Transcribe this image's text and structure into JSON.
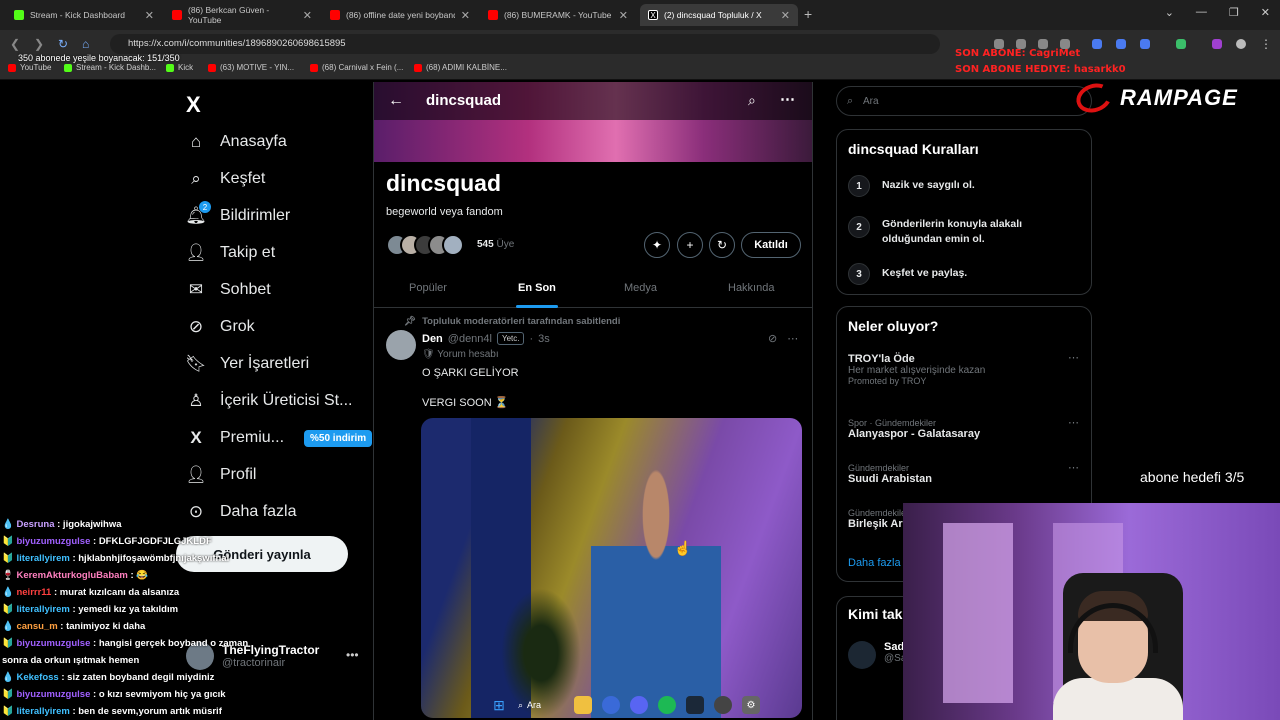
{
  "browser": {
    "tabs": [
      {
        "title": "Stream - Kick Dashboard",
        "color": "#53fc18"
      },
      {
        "title": "(86) Berkcan Güven - YouTube",
        "color": "#ff0000"
      },
      {
        "title": "(86) offline date yeni boyband",
        "color": "#ff0000"
      },
      {
        "title": "(86) BUMERAMK - YouTube",
        "color": "#ff0000"
      },
      {
        "title": "(2) dincsquad Topluluk / X",
        "color": "#ffffff"
      }
    ],
    "url": "https://x.com/i/communities/1896890260698615895",
    "bookmarks": [
      {
        "label": "YouTube",
        "color": "#ff0000"
      },
      {
        "label": "Stream - Kick Dashb...",
        "color": "#53fc18"
      },
      {
        "label": "Kick",
        "color": "#53fc18"
      },
      {
        "label": "(63) MOTIVE - YIN...",
        "color": "#ff0000"
      },
      {
        "label": "(68) Carnival x Fein (...",
        "color": "#ff0000"
      },
      {
        "label": "(68) ADIMI KALBİNE...",
        "color": "#ff0000"
      }
    ]
  },
  "overlay": {
    "sub_counter": "350 abonede yeşile boyanacak: 151/350",
    "last_sub": "SON ABONE: CagriMet",
    "last_gift": "SON ABONE HEDIYE: hasarkk0",
    "brand": "RAMPAGE",
    "goal": "abone hedefi 3/5"
  },
  "sidebar": {
    "logo": "X",
    "items": [
      {
        "label": "Anasayfa",
        "icon": "home-icon"
      },
      {
        "label": "Keşfet",
        "icon": "search-icon"
      },
      {
        "label": "Bildirimler",
        "icon": "bell-icon",
        "badge": "2"
      },
      {
        "label": "Takip et",
        "icon": "follow-icon"
      },
      {
        "label": "Sohbet",
        "icon": "mail-icon"
      },
      {
        "label": "Grok",
        "icon": "grok-icon"
      },
      {
        "label": "Yer İşaretleri",
        "icon": "bookmark-icon"
      },
      {
        "label": "İçerik Üreticisi St...",
        "icon": "creator-icon"
      },
      {
        "label": "Premiu...",
        "icon": "x-premium-icon",
        "pill": "%50 indirim"
      },
      {
        "label": "Profil",
        "icon": "profile-icon"
      },
      {
        "label": "Daha fazla",
        "icon": "more-icon"
      }
    ],
    "post_button": "Gönderi yayınla",
    "account": {
      "name": "TheFlyingTractor",
      "handle": "@tractorinair"
    }
  },
  "chat": [
    {
      "user": "Desruna",
      "color": "#c8a0ff",
      "text": ": jigokajwihwa"
    },
    {
      "user": "biyuzumuzgulse",
      "color": "#a060ff",
      "text": ": DFKLGFJGDFJLGJKLDF"
    },
    {
      "user": "literallyirem",
      "color": "#40c0ff",
      "text": ": hjklabnhjifoşawömbfjnıjakşwıfnal"
    },
    {
      "user": "KeremAkturkogluBabam",
      "color": "#ff80c0",
      "text": ": 😂"
    },
    {
      "user": "neirrr11",
      "color": "#ff4040",
      "text": ": murat kızılcanı da alsanıza"
    },
    {
      "user": "literallyirem",
      "color": "#40c0ff",
      "text": ": yemedi kız ya takıldım"
    },
    {
      "user": "cansu_m",
      "color": "#ffa040",
      "text": ": tanimiyoz ki daha"
    },
    {
      "user": "biyuzumuzgulse",
      "color": "#a060ff",
      "text": ": hangisi gerçek boyband o zaman"
    },
    {
      "user": "",
      "color": "#fff",
      "text": "sonra da orkun ışıtmak hemen"
    },
    {
      "user": "Kekefoss",
      "color": "#40c0ff",
      "text": ": siz zaten boyband degil miydiniz"
    },
    {
      "user": "biyuzumuzgulse",
      "color": "#a060ff",
      "text": ": o kızı sevmiyom hiç ya gıcık"
    },
    {
      "user": "literallyirem",
      "color": "#40c0ff",
      "text": ": ben de sevm,yorum artık müsrif"
    }
  ],
  "community": {
    "title": "dincsquad",
    "name": "dincsquad",
    "description": "begeworld veya fandom",
    "members_count": "545",
    "members_label": "Üye",
    "joined_label": "Katıldı",
    "tabs": [
      "Popüler",
      "En Son",
      "Medya",
      "Hakkında"
    ],
    "selected_tab": "En Son"
  },
  "post": {
    "pinned_label": "Topluluk moderatörleri tarafından sabitlendi",
    "author": "Den",
    "handle": "@denn4l",
    "mod_badge": "Yetc.",
    "time": "3s",
    "role": "Yorum hesabı",
    "text1": "O ŞARKI GELİYOR",
    "text2": "VERGI SOON ⏳"
  },
  "right": {
    "search_placeholder": "Ara",
    "rules_title": "dincsquad Kuralları",
    "rules": [
      {
        "num": "1",
        "text": "Nazik ve saygılı ol."
      },
      {
        "num": "2",
        "text": "Gönderilerin konuyla alakalı olduğundan emin ol."
      },
      {
        "num": "3",
        "text": "Keşfet ve paylaş."
      }
    ],
    "trends_title": "Neler oluyor?",
    "trends": [
      {
        "cat": "",
        "title": "TROY'la Öde",
        "sub": "Her market alışverişinde kazan",
        "promo": "Promoted by TROY"
      },
      {
        "cat": "Spor · Gündemdekiler",
        "title": "Alanyaspor - Galatasaray",
        "sub": "",
        "promo": ""
      },
      {
        "cat": "Gündemdekiler",
        "title": "Suudi Arabistan",
        "sub": "",
        "promo": ""
      },
      {
        "cat": "Gündemdekiler",
        "title": "Birleşik Ar",
        "sub": "",
        "promo": ""
      }
    ],
    "show_more": "Daha fazla",
    "follow_title": "Kimi tak",
    "follow_name": "Sad",
    "follow_handle": "@Sa"
  },
  "taskbar": {
    "search_label": "Ara"
  }
}
